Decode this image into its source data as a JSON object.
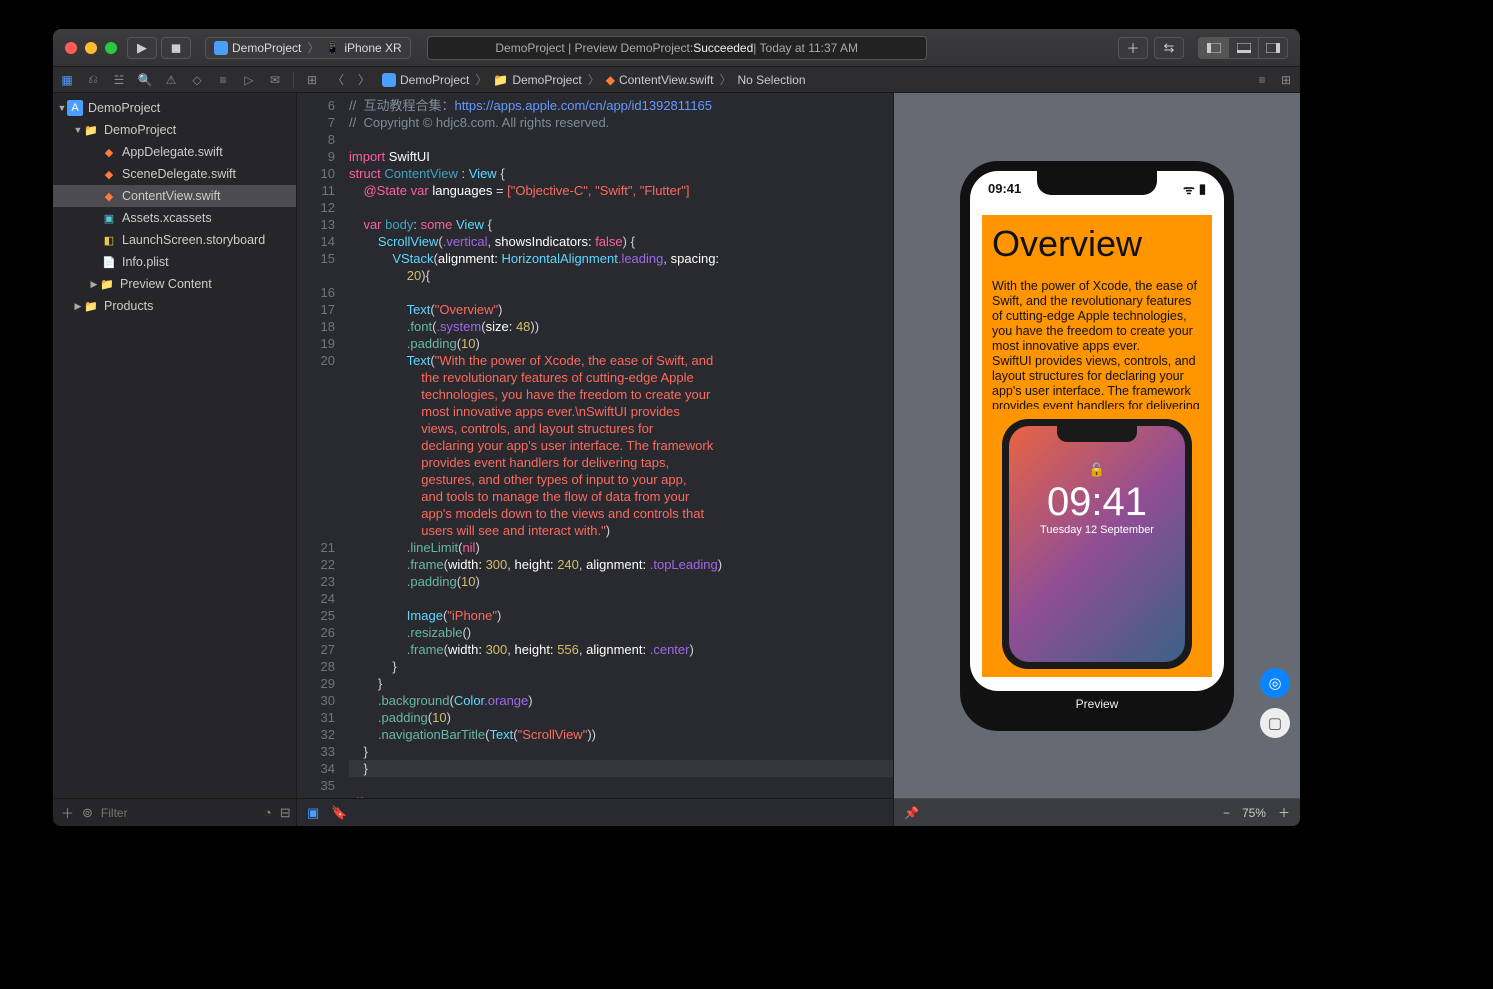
{
  "titlebar": {
    "scheme_app": "DemoProject",
    "scheme_device": "iPhone XR",
    "status_prefix": "DemoProject | Preview DemoProject: ",
    "status_result": "Succeeded",
    "status_time": " | Today at 11:37 AM"
  },
  "breadcrumbs": {
    "items": [
      "DemoProject",
      "DemoProject",
      "ContentView.swift",
      "No Selection"
    ]
  },
  "navigator": {
    "project": "DemoProject",
    "folder": "DemoProject",
    "files": [
      "AppDelegate.swift",
      "SceneDelegate.swift",
      "ContentView.swift",
      "Assets.xcassets",
      "LaunchScreen.storyboard",
      "Info.plist"
    ],
    "preview_folder": "Preview Content",
    "products": "Products",
    "filter_placeholder": "Filter"
  },
  "code": {
    "lines": {
      "l6": "互动教程合集：",
      "l6url": "https://apps.apple.com/cn/app/id1392811165",
      "l7": "Copyright © hdjc8.com. All rights reserved.",
      "l9i": "import",
      "l9m": "SwiftUI",
      "l10s": "struct",
      "l10n": "ContentView",
      "l10v": "View",
      "l11a": "@State",
      "l11v": "var",
      "l11n": "languages",
      "l11val": "[\"Objective-C\", \"Swift\", \"Flutter\"]",
      "l13v": "var",
      "l13b": "body",
      "l13s": "some",
      "l13t": "View",
      "l14sv": "ScrollView",
      "l14a1": ".vertical",
      "l14a2": "showsIndicators:",
      "l14f": "false",
      "l15vs": "VStack",
      "l15a": "alignment:",
      "l15h": "HorizontalAlignment",
      "l15l": ".leading",
      "l15s": "spacing:",
      "l16n": "20",
      "l17": "Text",
      "l17s": "\"Overview\"",
      "l18": ".font",
      "l18a": ".system",
      "l18b": "size:",
      "l18n": "48",
      "l19": ".padding",
      "l19n": "10",
      "l20": "Text",
      "l20s": "\"With the power of Xcode, the ease of Swift, and\n                    the revolutionary features of cutting-edge Apple\n                    technologies, you have the freedom to create your\n                    most innovative apps ever.\\nSwiftUI provides\n                    views, controls, and layout structures for\n                    declaring your app's user interface. The framework\n                    provides event handlers for delivering taps,\n                    gestures, and other types of input to your app,\n                    and tools to manage the flow of data from your\n                    app's models down to the views and controls that\n                    users will see and interact with.\"",
      "l21": ".lineLimit",
      "l21n": "nil",
      "l22": ".frame",
      "l22w": "width:",
      "l22wn": "300",
      "l22h": "height:",
      "l22hn": "240",
      "l22a": "alignment:",
      "l22al": ".topLeading",
      "l23": ".padding",
      "l23n": "10",
      "l25": "Image",
      "l25s": "\"iPhone\"",
      "l26": ".resizable",
      "l27": ".frame",
      "l27wn": "300",
      "l27hn": "556",
      "l27al": ".center",
      "l30": ".background",
      "l30c": "Color",
      "l30o": ".orange",
      "l31": ".padding",
      "l31n": "10",
      "l32": ".navigationBarTitle",
      "l32t": "Text",
      "l32s": "\"ScrollView\"",
      "l35": "#if",
      "l35d": "DEBUG"
    },
    "gutter": [
      "6",
      "7",
      "8",
      "9",
      "10",
      "11",
      "12",
      "13",
      "14",
      "15",
      "",
      "16",
      "17",
      "18",
      "19",
      "20",
      "",
      "",
      "",
      "",
      "",
      "",
      "",
      "",
      "",
      "",
      "21",
      "22",
      "23",
      "24",
      "25",
      "26",
      "27",
      "28",
      "29",
      "30",
      "31",
      "32",
      "33",
      "34",
      "35"
    ]
  },
  "preview": {
    "status_time": "09:41",
    "title": "Overview",
    "body": "With the power of Xcode, the ease of Swift, and the revolutionary features of cutting-edge Apple technologies, you have the freedom to create your most innovative apps ever.\nSwiftUI provides views, controls, and layout structures for declaring your app's user interface. The framework provides event handlers for delivering taps, gestures, and other types of inp…",
    "lock_time": "09:41",
    "lock_date": "Tuesday 12 September",
    "label": "Preview",
    "zoom": "75%"
  }
}
